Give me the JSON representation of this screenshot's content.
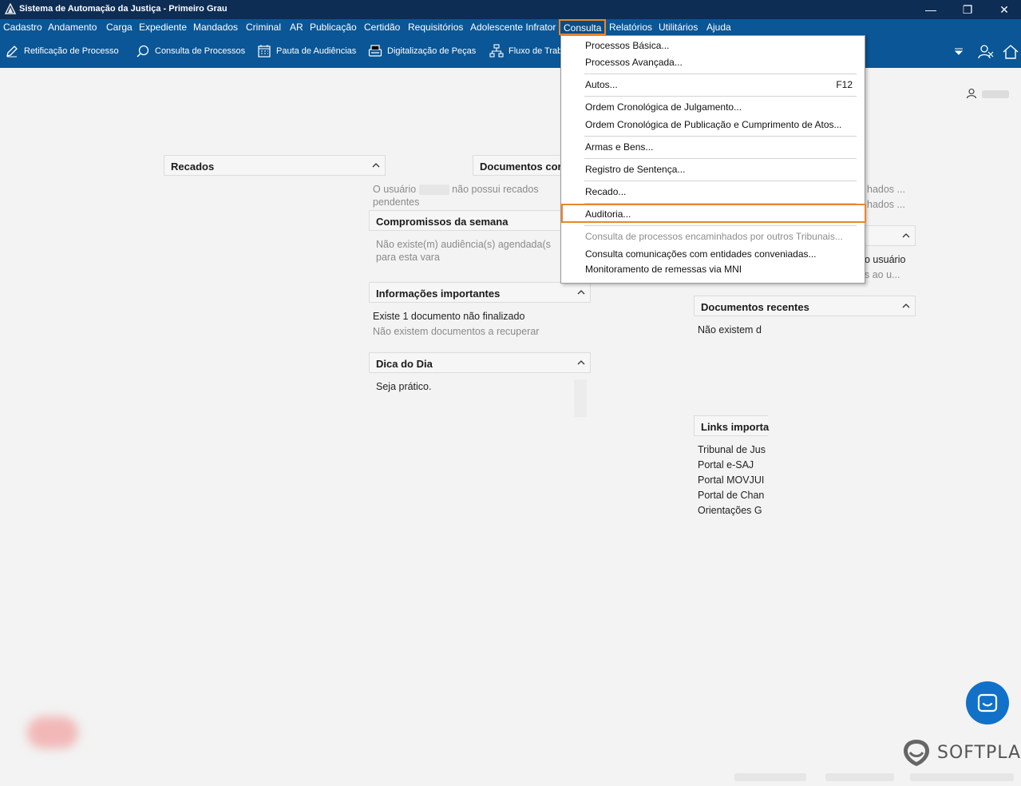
{
  "window": {
    "title": "Sistema de Automação da Justiça - Primeiro Grau",
    "minimize": "—",
    "restore": "❐",
    "close": "✕"
  },
  "menubar": {
    "items": [
      "Cadastro",
      "Andamento",
      "Carga",
      "Expediente",
      "Mandados",
      "Criminal",
      "AR",
      "Publicação",
      "Certidão",
      "Requisitórios",
      "Adolescente Infrator",
      "Consulta",
      "Relatórios",
      "Utilitários",
      "Ajuda"
    ],
    "active": "Consulta"
  },
  "toolbar": {
    "retificacao": "Retificação de Processo",
    "consulta": "Consulta de Processos",
    "pauta": "Pauta de Audiências",
    "digitalizacao": "Digitalização de Peças",
    "fluxo": "Fluxo de Trab"
  },
  "consulta_menu": {
    "processos_basica": "Processos Básica...",
    "processos_avancada": "Processos Avançada...",
    "autos": "Autos...",
    "autos_shortcut": "F12",
    "ordem_julgamento": "Ordem Cronológica de Julgamento...",
    "ordem_publicacao": "Ordem Cronológica de Publicação e Cumprimento de Atos...",
    "armas": "Armas e Bens...",
    "registro_sentenca": "Registro de Sentença...",
    "recado": "Recado...",
    "auditoria": "Auditoria...",
    "encaminhados": "Consulta de processos encaminhados por outros Tribunais...",
    "comunicacoes": "Consulta comunicações com entidades conveniadas...",
    "monitoramento": "Monitoramento de remessas via MNI"
  },
  "panels": {
    "recados": {
      "title": "Recados"
    },
    "documentos_col": {
      "title": "Documentos cor"
    },
    "usuario_msg_a": "O usuário",
    "usuario_msg_b": "não possui recados",
    "usuario_msg_c": "pendentes",
    "compromissos": {
      "title": "Compromissos da semana",
      "line1": "Não existe(m) audiência(s) agendada(s",
      "line2": "para esta vara"
    },
    "informacoes": {
      "title": "Informações importantes",
      "line1": "Existe 1 documento não finalizado",
      "line2": "Não existem documentos a recuperar"
    },
    "dica": {
      "title": "Dica do Dia",
      "text": "Seja prático."
    },
    "right_partial": {
      "l1": "hados ...",
      "l2": "hados ...",
      "l3": "o usuário",
      "l4": "s ao u..."
    },
    "documentos_recentes": {
      "title": "Documentos recentes",
      "text": "Não existem d"
    },
    "links": {
      "title": "Links importa",
      "items": [
        "Tribunal de Jus",
        "Portal e-SAJ",
        "Portal MOVJUI",
        "Portal de Chan",
        "Orientações G"
      ]
    }
  },
  "brand": {
    "name": "SOFTPLAN"
  },
  "colors": {
    "titlebar": "#0d2d55",
    "menubar": "#0a5696",
    "highlight": "#e9862b",
    "chat": "#1171c9"
  }
}
